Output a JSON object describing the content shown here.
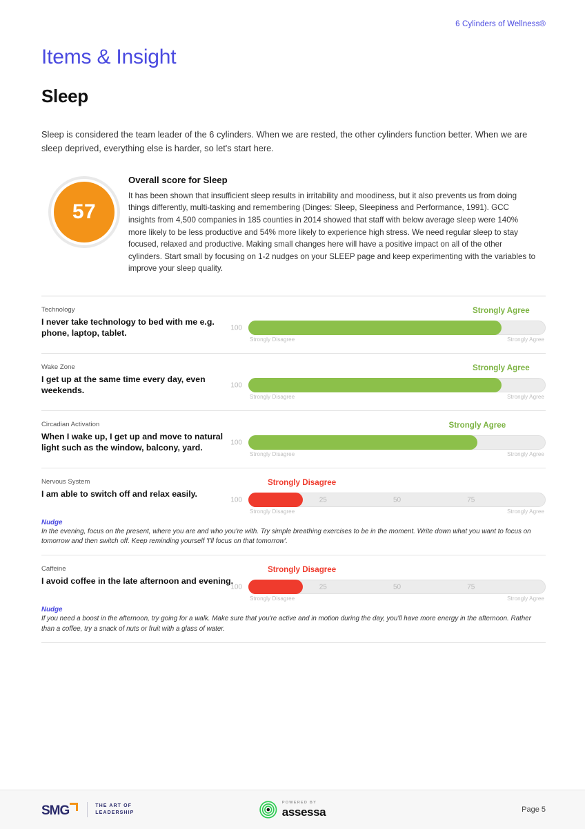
{
  "header": {
    "brand": "6 Cylinders of Wellness®",
    "brand_color": "#4a4ae0"
  },
  "title": {
    "section": "Items & Insight",
    "cylinder": "Sleep"
  },
  "intro": "Sleep is considered the team leader of the 6 cylinders. When we are rested, the other cylinders function better. When we are sleep deprived, everything else is harder, so let's start here.",
  "overall": {
    "score": "57",
    "score_color": "#f39318",
    "heading": "Overall score for Sleep",
    "body": "It has been shown that insufficient sleep results in irritability and moodiness, but it also prevents us from doing things differently, multi-tasking and remembering (Dinges: Sleep, Sleepiness and Performance, 1991). GCC insights from 4,500 companies in 185 counties in 2014 showed that staff with below average sleep were 140% more likely to be less productive and 54% more likely to experience high stress. We need regular sleep to stay focused, relaxed and productive. Making small changes here will have a positive impact on all of the other cylinders. Start small by focusing on 1-2 nudges on your SLEEP page and keep experimenting with the variables to improve your sleep quality."
  },
  "scale": {
    "low_label": "Strongly Disagree",
    "high_label": "Strongly Agree",
    "ticks": [
      "25",
      "50",
      "75",
      "100"
    ],
    "green": "#8cc04a",
    "red": "#ef3b2d"
  },
  "items": [
    {
      "category": "Technology",
      "question": "I never take technology to bed with me e.g. phone, laptop, tablet.",
      "result_label": "Strongly Agree",
      "result_tone": "green",
      "value": 85,
      "show_mid_ticks": false,
      "tick_end": "100",
      "nudge": null
    },
    {
      "category": "Wake Zone",
      "question": "I get up at the same time every day, even weekends.",
      "result_label": "Strongly Agree",
      "result_tone": "green",
      "value": 85,
      "show_mid_ticks": false,
      "tick_end": "100",
      "nudge": null
    },
    {
      "category": "Circadian Activation",
      "question": "When I wake up, I get up and move to natural light such as the window, balcony, yard.",
      "result_label": "Strongly Agree",
      "result_tone": "green",
      "value": 77,
      "show_mid_ticks": false,
      "tick_end": "100",
      "nudge": null
    },
    {
      "category": "Nervous System",
      "question": "I am able to switch off and relax easily.",
      "result_label": "Strongly Disagree",
      "result_tone": "red",
      "value": 18,
      "show_mid_ticks": true,
      "tick_end": "100",
      "nudge": {
        "label": "Nudge",
        "text": "In the evening, focus on the present, where you are and who you're with. Try simple breathing exercises to be in the moment. Write down what you want to focus on tomorrow and then switch off. Keep reminding yourself 'I'll focus on that tomorrow'."
      }
    },
    {
      "category": "Caffeine",
      "question": "I avoid coffee in the late afternoon and evening.",
      "result_label": "Strongly Disagree",
      "result_tone": "red",
      "value": 18,
      "show_mid_ticks": true,
      "tick_end": "100",
      "nudge": {
        "label": "Nudge",
        "text": "If you need a boost in the afternoon, try going for a walk. Make sure that you're active and in motion during the day, you'll have more energy in the afternoon. Rather than a coffee, try a snack of nuts or fruit with a glass of water."
      }
    }
  ],
  "footer": {
    "smg_mark": "SMG",
    "smg_tagline_line1": "THE ART OF",
    "smg_tagline_line2": "LEADERSHIP",
    "powered_by": "POWERED BY",
    "assessa": "assessa",
    "page_label": "Page 5"
  }
}
